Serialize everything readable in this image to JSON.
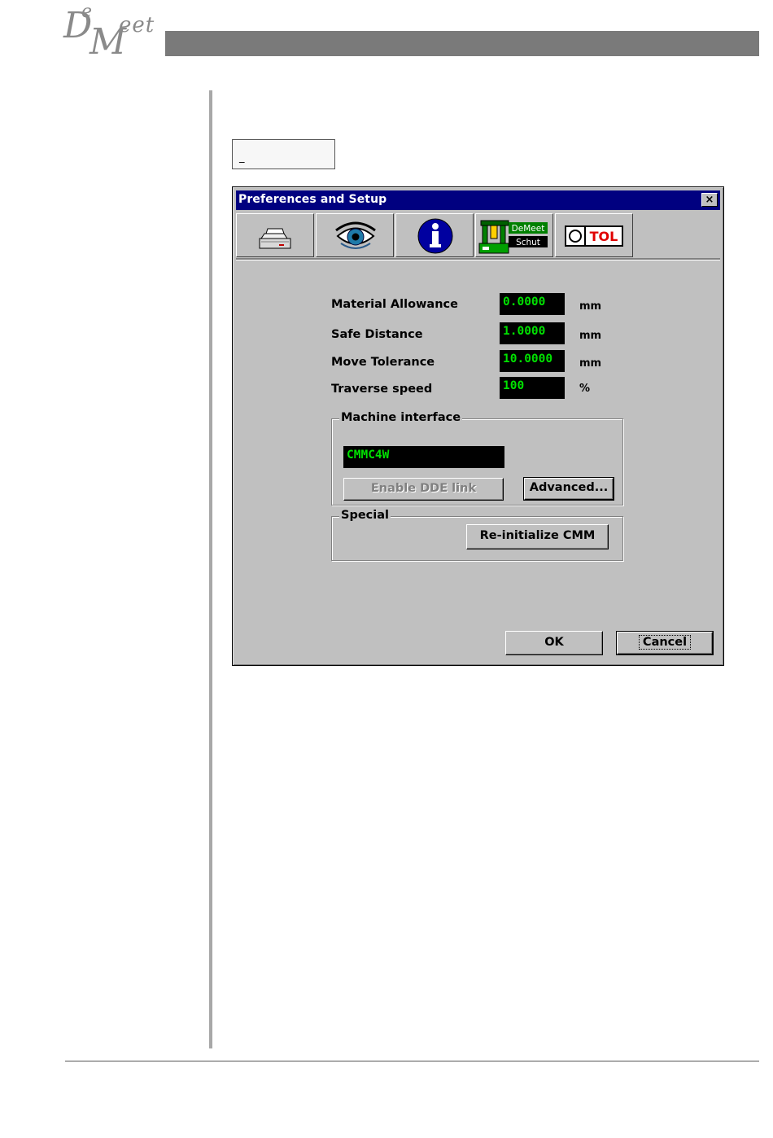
{
  "logo": {
    "text_parts": [
      "D",
      "e",
      "M",
      "eet"
    ]
  },
  "stub_box": {
    "text": "_"
  },
  "dialog": {
    "title": "Preferences and Setup",
    "close_label": "×",
    "tabs": [
      {
        "icon": "printer-icon"
      },
      {
        "icon": "eye-icon"
      },
      {
        "icon": "info-icon"
      },
      {
        "icon": "cmm-machine-icon",
        "badge_top": "DeMeet",
        "badge_bottom": "Schut"
      },
      {
        "icon": "tolerance-icon",
        "text": "TOL"
      }
    ],
    "fields": [
      {
        "label": "Material Allowance",
        "value": "0.0000",
        "unit": "mm"
      },
      {
        "label": "Safe Distance",
        "value": "1.0000",
        "unit": "mm"
      },
      {
        "label": "Move Tolerance",
        "value": "10.0000",
        "unit": "mm"
      },
      {
        "label": "Traverse speed",
        "value": "100",
        "unit": "%"
      }
    ],
    "machine_interface": {
      "title": "Machine interface",
      "value": "CMMC4W",
      "enable_dde_label": "Enable DDE link",
      "advanced_label": "Advanced..."
    },
    "special": {
      "title": "Special",
      "reinit_label": "Re-initialize CMM"
    },
    "ok_label": "OK",
    "cancel_label": "Cancel"
  },
  "colors": {
    "titlebar": "#000080",
    "dialog_face": "#c0c0c0",
    "field_bg": "#000000",
    "field_text": "#00e000",
    "header_bar": "#7a7a7a"
  }
}
